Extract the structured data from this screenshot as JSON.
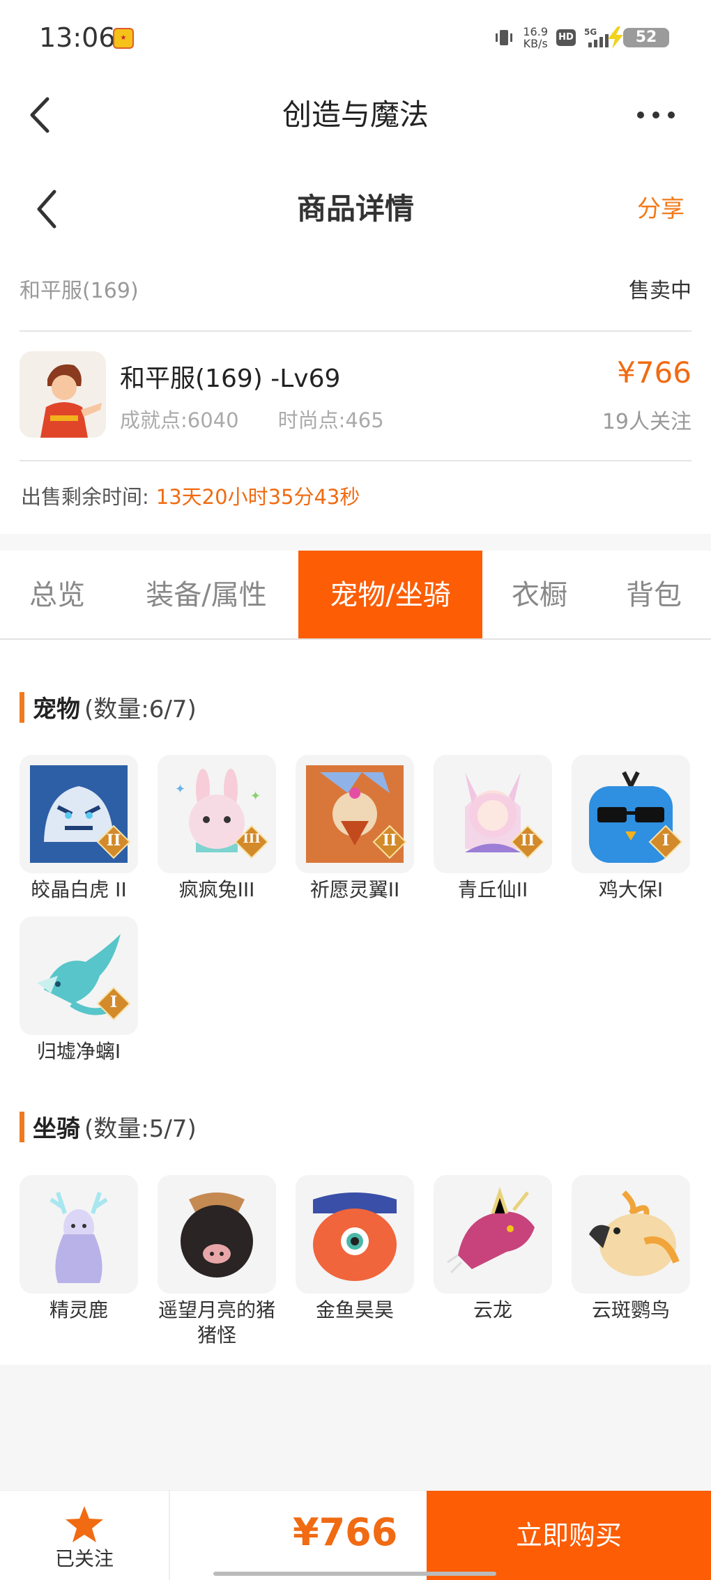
{
  "status_bar": {
    "time": "13:06",
    "net_speed_value": "16.9",
    "net_speed_unit": "KB/s",
    "hd": "HD",
    "network": "5G",
    "battery": "52"
  },
  "header": {
    "app_title": "创造与魔法",
    "page_title": "商品详情",
    "share_label": "分享"
  },
  "listing": {
    "server": "和平服(169)",
    "status": "售卖中",
    "name": "和平服(169) -Lv69",
    "achievement": "成就点:6040",
    "fashion": "时尚点:465",
    "price": "¥766",
    "followers": "19人关注",
    "remaining_label": "出售剩余时间:",
    "remaining_time": "13天20小时35分43秒"
  },
  "tabs": [
    {
      "label": "总览",
      "active": false
    },
    {
      "label": "装备/属性",
      "active": false
    },
    {
      "label": "宠物/坐骑",
      "active": true
    },
    {
      "label": "衣橱",
      "active": false
    },
    {
      "label": "背包",
      "active": false
    }
  ],
  "pets": {
    "title": "宠物",
    "count": "(数量:6/7)",
    "items": [
      {
        "name": "皎晶白虎 II",
        "badge": "II",
        "icon": "tiger-icon",
        "color": "#3a6fb8"
      },
      {
        "name": "疯疯兔III",
        "badge": "III",
        "icon": "rabbit-icon",
        "color": "#f3b7c9"
      },
      {
        "name": "祈愿灵翼II",
        "badge": "II",
        "icon": "eagle-icon",
        "color": "#c0552a"
      },
      {
        "name": "青丘仙II",
        "badge": "II",
        "icon": "fox-fairy-icon",
        "color": "#e7b2d6"
      },
      {
        "name": "鸡大保I",
        "badge": "I",
        "icon": "blue-bird-icon",
        "color": "#2f8fe0"
      },
      {
        "name": "归墟净螭I",
        "badge": "I",
        "icon": "dragon-icon",
        "color": "#57c5c9"
      }
    ]
  },
  "mounts": {
    "title": "坐骑",
    "count": "(数量:5/7)",
    "items": [
      {
        "name": "精灵鹿",
        "icon": "deer-icon",
        "color": "#b9b2e8"
      },
      {
        "name": "遥望月亮的猪猪怪",
        "icon": "pig-icon",
        "color": "#2a2424"
      },
      {
        "name": "金鱼昊昊",
        "icon": "goldfish-icon",
        "color": "#f0653c"
      },
      {
        "name": "云龙",
        "icon": "cloud-dragon-icon",
        "color": "#c8437b"
      },
      {
        "name": "云斑鹦鸟",
        "icon": "parrot-icon",
        "color": "#f0a43a"
      }
    ]
  },
  "bottom_bar": {
    "follow_label": "已关注",
    "price": "¥766",
    "buy_label": "立即购买"
  },
  "colors": {
    "accent": "#fc5d05",
    "price": "#f06b12"
  }
}
